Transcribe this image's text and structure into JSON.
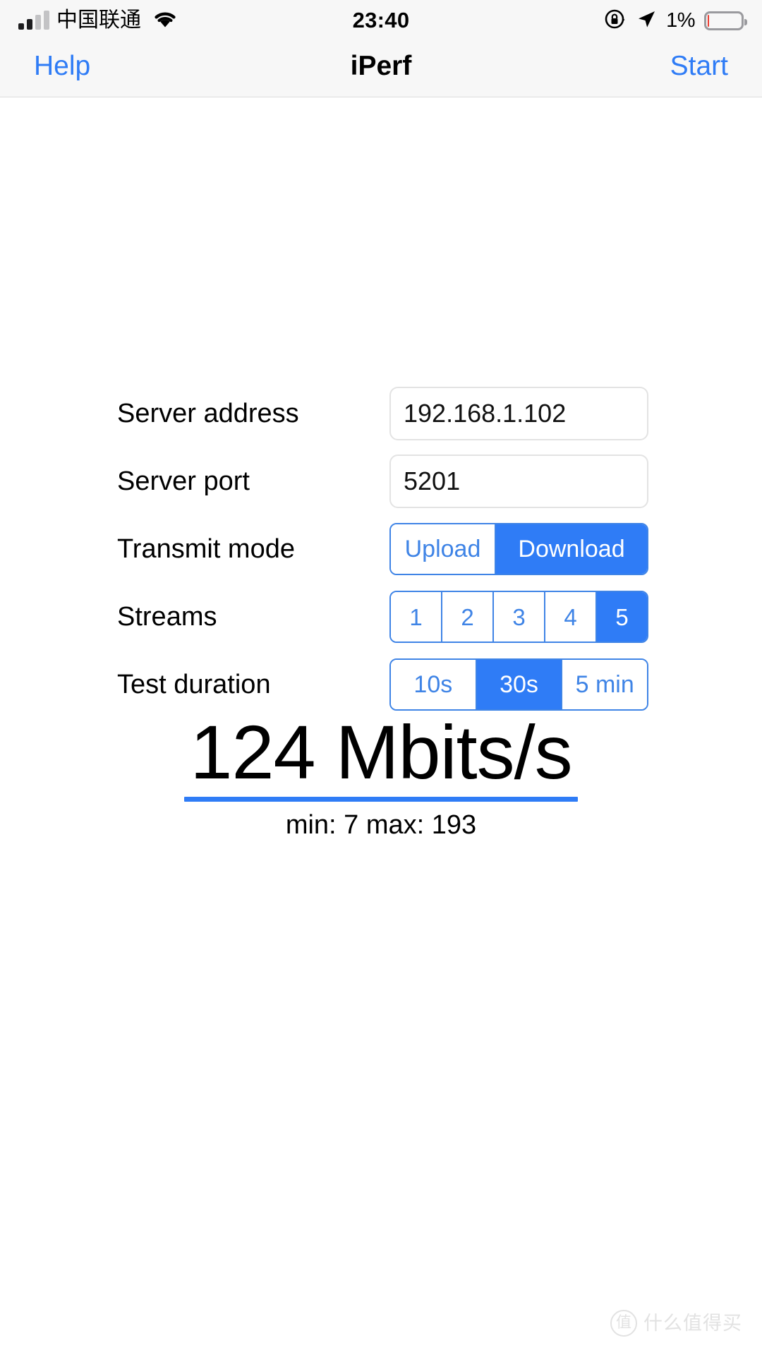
{
  "status_bar": {
    "carrier": "中国联通",
    "signal_icon": "cellular-signal-icon",
    "signal_bars_filled": 2,
    "signal_bars_total": 4,
    "wifi_icon": "wifi-icon",
    "time": "23:40",
    "rotation_lock_icon": "rotation-lock-icon",
    "location_icon": "location-arrow-icon",
    "battery_percent": "1%",
    "battery_level": 1,
    "battery_icon": "battery-icon",
    "battery_color": "#eb3b30"
  },
  "nav_bar": {
    "left_button": "Help",
    "title": "iPerf",
    "right_button": "Start",
    "tint_color": "#2f7cf6"
  },
  "form": {
    "rows": [
      {
        "label": "Server address",
        "type": "text",
        "value": "192.168.1.102",
        "placeholder": "Server address"
      },
      {
        "label": "Server port",
        "type": "text",
        "value": "5201",
        "placeholder": "Server port"
      },
      {
        "label": "Transmit mode",
        "type": "segmented",
        "options": [
          "Upload",
          "Download"
        ],
        "selected": 1
      },
      {
        "label": "Streams",
        "type": "segmented",
        "options": [
          "1",
          "2",
          "3",
          "4",
          "5"
        ],
        "selected": 4
      },
      {
        "label": "Test duration",
        "type": "segmented",
        "options": [
          "10s",
          "30s",
          "5 min"
        ],
        "selected": 1
      }
    ]
  },
  "result": {
    "value": "124 Mbits/s",
    "throughput": 124,
    "unit": "Mbits/s",
    "min_max": "min: 7 max: 193",
    "min": 7,
    "max": 193,
    "rule_color": "#2f7cf6"
  },
  "watermark": {
    "badge": "值",
    "text": "什么值得买"
  }
}
